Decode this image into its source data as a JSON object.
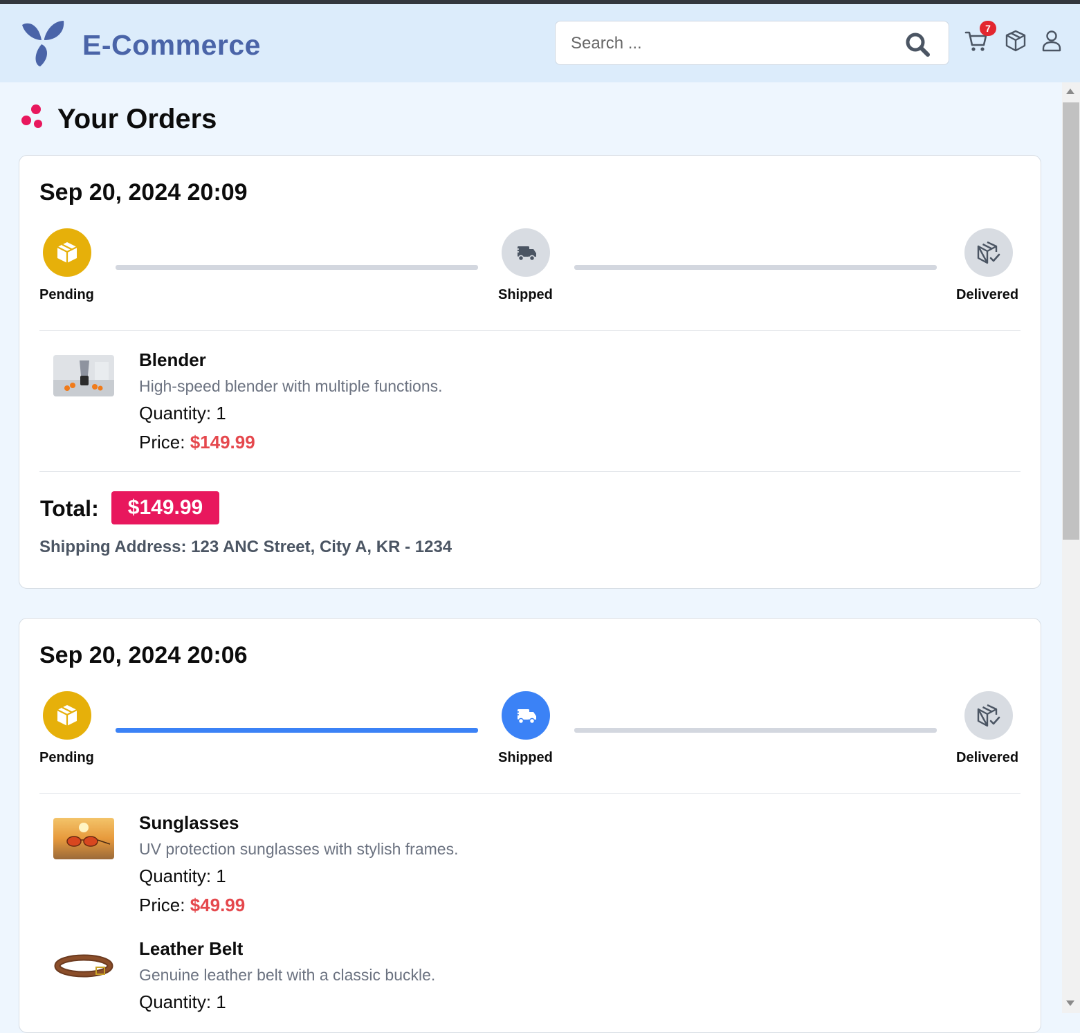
{
  "header": {
    "brand": "E-Commerce",
    "search_placeholder": "Search ...",
    "cart_count": "7",
    "icons": [
      "search-icon",
      "cart-icon",
      "package-icon",
      "user-icon"
    ]
  },
  "page": {
    "title": "Your Orders"
  },
  "colors": {
    "accent": "#e8175d",
    "brand": "#4a64a8",
    "pending": "#e6b00a",
    "active_step": "#3b82f6",
    "inactive_step": "#d3d7df",
    "price": "#e5484d"
  },
  "orders": [
    {
      "date": "Sep 20, 2024 20:09",
      "steps": [
        {
          "label": "Pending",
          "state": "done"
        },
        {
          "label": "Shipped",
          "state": "pending"
        },
        {
          "label": "Delivered",
          "state": "pending"
        }
      ],
      "items": [
        {
          "name": "Blender",
          "description": "High-speed blender with multiple functions.",
          "quantity": "Quantity: 1",
          "price_label": "Price: ",
          "price": "$149.99"
        }
      ],
      "total_label": "Total:",
      "total": "$149.99",
      "shipping_address": "Shipping Address: 123 ANC Street, City A, KR - 1234"
    },
    {
      "date": "Sep 20, 2024 20:06",
      "steps": [
        {
          "label": "Pending",
          "state": "done"
        },
        {
          "label": "Shipped",
          "state": "active"
        },
        {
          "label": "Delivered",
          "state": "pending"
        }
      ],
      "items": [
        {
          "name": "Sunglasses",
          "description": "UV protection sunglasses with stylish frames.",
          "quantity": "Quantity: 1",
          "price_label": "Price: ",
          "price": "$49.99"
        },
        {
          "name": "Leather Belt",
          "description": "Genuine leather belt with a classic buckle.",
          "quantity": "Quantity: 1"
        }
      ]
    }
  ]
}
